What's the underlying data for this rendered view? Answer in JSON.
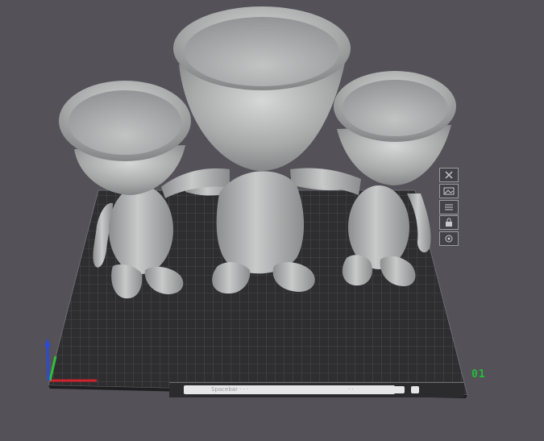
{
  "viewport": {
    "axis_gizmo_label": "01",
    "status_strip": {
      "path_text": "Spacebar  ·  ·  ·",
      "right_text": "· ·"
    },
    "side_toolbar": [
      "close-icon",
      "image-icon",
      "list-icon",
      "lock-icon",
      "view-icon"
    ],
    "colors": {
      "background": "#545258",
      "build_plate": "#2e2e30",
      "grid_line": "#5a5a60",
      "model": "#b4b6b6",
      "axis_x": "#d1222b",
      "axis_y": "#2fbf3a",
      "axis_z": "#2b4ad8"
    }
  }
}
